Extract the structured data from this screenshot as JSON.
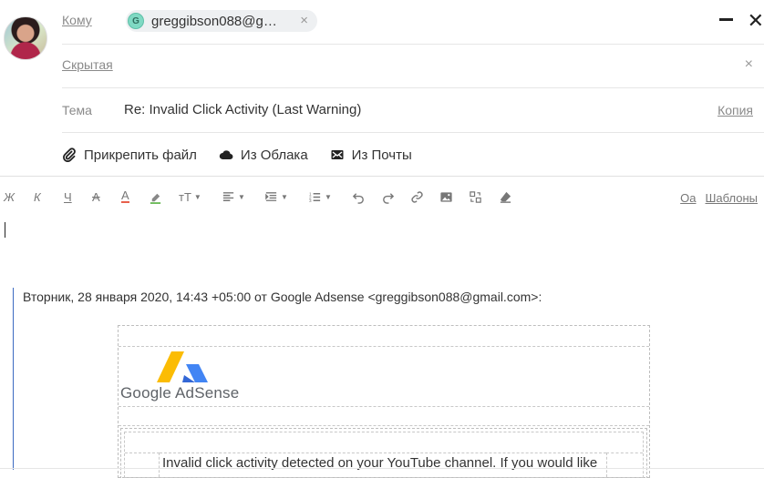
{
  "recipients": {
    "to_label": "Кому",
    "chip_initial": "G",
    "chip_email": "greggibson088@g…",
    "bcc_label": "Скрытая",
    "subject_label": "Тема",
    "subject_value": "Re: Invalid Click Activity (Last Warning)",
    "copy_label": "Копия"
  },
  "attachments": {
    "attach_file": "Прикрепить файл",
    "from_cloud": "Из Облака",
    "from_mail": "Из Почты"
  },
  "toolbar": {
    "bold": "Ж",
    "italic": "К",
    "underline": "Ч",
    "strike": "А",
    "font_color": "А",
    "font_size": "тТ",
    "templates": "Шаблоны"
  },
  "quote": {
    "header": "Вторник, 28 января 2020, 14:43 +05:00 от Google Adsense <greggibson088@gmail.com>:"
  },
  "email": {
    "logo_text": "Google AdSense",
    "body_line": "Invalid click activity detected on your YouTube channel. If you would like"
  },
  "colors": {
    "quote_bar": "#3d6bc1",
    "chip_avatar": "#7fd9c3",
    "adsense_yellow": "#fbbc04",
    "adsense_blue": "#4285f4"
  }
}
